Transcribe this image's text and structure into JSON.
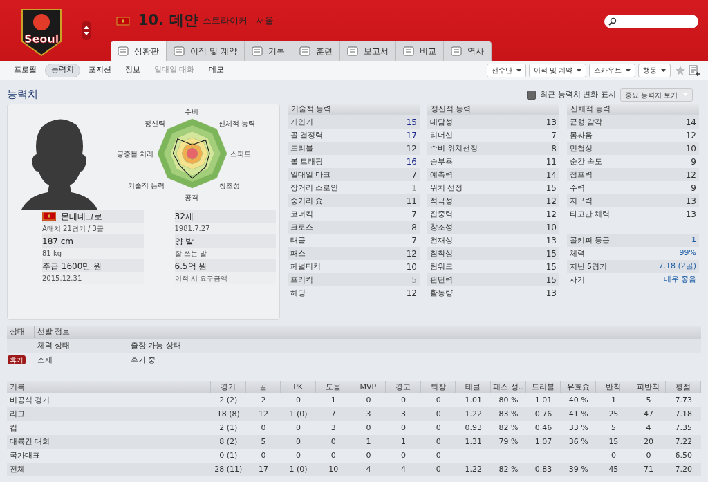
{
  "header": {
    "logo_text": "Seoul",
    "player_name": "10. 데얀",
    "position": "스트라이커 - 서울"
  },
  "tabs": [
    {
      "label": "상황판",
      "selected": true
    },
    {
      "label": "이적 및 계약",
      "selected": false
    },
    {
      "label": "기록",
      "selected": false
    },
    {
      "label": "훈련",
      "selected": false
    },
    {
      "label": "보고서",
      "selected": false
    },
    {
      "label": "비교",
      "selected": false
    },
    {
      "label": "역사",
      "selected": false
    }
  ],
  "subnav": [
    {
      "label": "프로필",
      "selected": false,
      "disabled": false
    },
    {
      "label": "능력치",
      "selected": true,
      "disabled": false
    },
    {
      "label": "포지션",
      "selected": false,
      "disabled": false
    },
    {
      "label": "정보",
      "selected": false,
      "disabled": false
    },
    {
      "label": "일대일 대화",
      "selected": false,
      "disabled": true
    },
    {
      "label": "메모",
      "selected": false,
      "disabled": false
    }
  ],
  "actions": [
    "선수단",
    "이적 및 계약",
    "스카우트",
    "행동"
  ],
  "section_title": "능력치",
  "options": {
    "show_changes": {
      "label": "최근 능력치 변화 표시",
      "checked": false
    },
    "view": "중요 능력치 보기"
  },
  "radar_labels": [
    "수비",
    "정신력",
    "신체적 능력",
    "공중볼 처리",
    "스피드",
    "기술적 능력",
    "창조성",
    "공격"
  ],
  "profile": [
    {
      "main": "몬테네그로",
      "sub": "A매치 21경기 / 3골",
      "flag": true
    },
    {
      "main": "32세",
      "sub": "1981.7.27",
      "flag": false
    },
    {
      "main": "187 cm",
      "sub": "81 kg",
      "flag": false
    },
    {
      "main": "양 발",
      "sub": "잘 쓰는 발",
      "flag": false
    },
    {
      "main": "주급 1600만 원",
      "sub": "2015.12.31",
      "flag": false
    },
    {
      "main": "6.5억 원",
      "sub": "이적 시 요구금액",
      "flag": false
    }
  ],
  "attribute_groups": [
    {
      "title": "기술적 능력",
      "rows": [
        {
          "name": "개인기",
          "value": "15",
          "color": "#1d2a8c"
        },
        {
          "name": "골 결정력",
          "value": "17",
          "color": "#1d2a8c"
        },
        {
          "name": "드리블",
          "value": "12",
          "color": "#333333"
        },
        {
          "name": "볼 트래핑",
          "value": "16",
          "color": "#1d2a8c"
        },
        {
          "name": "일대일 마크",
          "value": "7",
          "color": "#333333"
        },
        {
          "name": "장거리 스로인",
          "value": "1",
          "color": "#999999"
        },
        {
          "name": "중거리 슛",
          "value": "11",
          "color": "#333333"
        },
        {
          "name": "코너킥",
          "value": "7",
          "color": "#333333"
        },
        {
          "name": "크로스",
          "value": "8",
          "color": "#333333"
        },
        {
          "name": "태클",
          "value": "7",
          "color": "#333333"
        },
        {
          "name": "패스",
          "value": "12",
          "color": "#333333"
        },
        {
          "name": "페널티킥",
          "value": "10",
          "color": "#333333"
        },
        {
          "name": "프리킥",
          "value": "5",
          "color": "#999999"
        },
        {
          "name": "헤딩",
          "value": "12",
          "color": "#333333"
        }
      ]
    },
    {
      "title": "정신적 능력",
      "rows": [
        {
          "name": "대담성",
          "value": "13",
          "color": "#333333"
        },
        {
          "name": "리더십",
          "value": "7",
          "color": "#333333"
        },
        {
          "name": "수비 위치선정",
          "value": "8",
          "color": "#333333"
        },
        {
          "name": "승부욕",
          "value": "11",
          "color": "#333333"
        },
        {
          "name": "예측력",
          "value": "14",
          "color": "#333333"
        },
        {
          "name": "위치 선정",
          "value": "15",
          "color": "#333333"
        },
        {
          "name": "적극성",
          "value": "12",
          "color": "#333333"
        },
        {
          "name": "집중력",
          "value": "12",
          "color": "#333333"
        },
        {
          "name": "창조성",
          "value": "10",
          "color": "#333333"
        },
        {
          "name": "천재성",
          "value": "13",
          "color": "#333333"
        },
        {
          "name": "침착성",
          "value": "15",
          "color": "#333333"
        },
        {
          "name": "팀워크",
          "value": "15",
          "color": "#333333"
        },
        {
          "name": "판단력",
          "value": "15",
          "color": "#333333"
        },
        {
          "name": "활동량",
          "value": "13",
          "color": "#333333"
        }
      ]
    },
    {
      "title": "신체적 능력",
      "rows": [
        {
          "name": "균형 감각",
          "value": "14",
          "color": "#333333"
        },
        {
          "name": "몸싸움",
          "value": "12",
          "color": "#333333"
        },
        {
          "name": "민첩성",
          "value": "10",
          "color": "#333333"
        },
        {
          "name": "순간 속도",
          "value": "9",
          "color": "#333333"
        },
        {
          "name": "점프력",
          "value": "12",
          "color": "#333333"
        },
        {
          "name": "주력",
          "value": "9",
          "color": "#333333"
        },
        {
          "name": "지구력",
          "value": "13",
          "color": "#333333"
        },
        {
          "name": "타고난 체력",
          "value": "13",
          "color": "#333333"
        }
      ]
    }
  ],
  "extra_stats": [
    {
      "name": "골키퍼 등급",
      "value": "1"
    },
    {
      "name": "체력",
      "value": "99%"
    },
    {
      "name": "지난 5경기",
      "value": "7.18 (2골)"
    },
    {
      "name": "사기",
      "value": "매우 좋음"
    }
  ],
  "status": {
    "headers": [
      "상태",
      "선발 정보"
    ],
    "columns": [
      "체력 상태",
      "출장 가능 상태"
    ],
    "rows": [
      {
        "badge": "휴가",
        "cells": [
          "소재",
          "휴가 중"
        ]
      }
    ]
  },
  "stats": {
    "columns": [
      "기록",
      "경기",
      "골",
      "PK",
      "도움",
      "MVP",
      "경고",
      "퇴장",
      "태클",
      "패스 성..",
      "드리블",
      "유효슛",
      "반칙",
      "피반칙",
      "평점"
    ],
    "rows": [
      [
        "비공식 경기",
        "2 (2)",
        "2",
        "0",
        "1",
        "0",
        "0",
        "0",
        "1.01",
        "80 %",
        "1.01",
        "40 %",
        "1",
        "5",
        "7.73"
      ],
      [
        "리그",
        "18 (8)",
        "12",
        "1 (0)",
        "7",
        "3",
        "3",
        "0",
        "1.22",
        "83 %",
        "0.76",
        "41 %",
        "25",
        "47",
        "7.18"
      ],
      [
        "컵",
        "2 (1)",
        "0",
        "0",
        "3",
        "0",
        "0",
        "0",
        "0.93",
        "82 %",
        "0.46",
        "33 %",
        "5",
        "4",
        "7.35"
      ],
      [
        "대륙간 대회",
        "8 (2)",
        "5",
        "0",
        "0",
        "1",
        "1",
        "0",
        "1.31",
        "79 %",
        "1.07",
        "36 %",
        "15",
        "20",
        "7.22"
      ],
      [
        "국가대표",
        "0 (1)",
        "0",
        "0",
        "0",
        "0",
        "0",
        "0",
        "-",
        "-",
        "-",
        "-",
        "0",
        "0",
        "6.50"
      ],
      [
        "전체",
        "28 (11)",
        "17",
        "1 (0)",
        "10",
        "4",
        "4",
        "0",
        "1.22",
        "82 %",
        "0.83",
        "39 %",
        "45",
        "71",
        "7.20"
      ]
    ]
  }
}
